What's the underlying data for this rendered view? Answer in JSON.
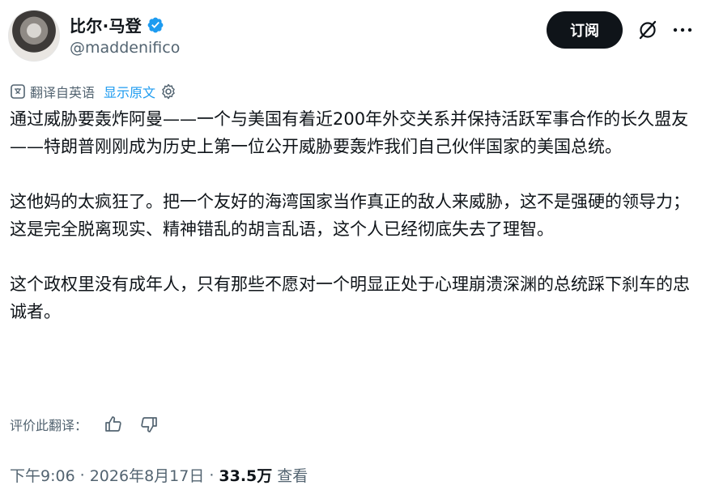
{
  "author": {
    "display_name": "比尔·马登",
    "handle": "@maddenifico",
    "verified": true,
    "verified_color": "#1d9bf0"
  },
  "header": {
    "subscribe_label": "订阅"
  },
  "translation": {
    "notice": "翻译自英语",
    "show_original": "显示原文"
  },
  "post": {
    "paragraphs": [
      "通过威胁要轰炸阿曼——一个与美国有着近200年外交关系并保持活跃军事合作的长久盟友——特朗普刚刚成为历史上第一位公开威胁要轰炸我们自己伙伴国家的美国总统。",
      "这他妈的太疯狂了。把一个友好的海湾国家当作真正的敌人来威胁，这不是强硬的领导力；这是完全脱离现实、精神错乱的胡言乱语，这个人已经彻底失去了理智。",
      "这个政权里没有成年人，只有那些不愿对一个明显正处于心理崩溃深渊的总统踩下刹车的忠诚者。"
    ]
  },
  "rating": {
    "label": "评价此翻译："
  },
  "meta": {
    "time": "下午9:06",
    "date": "2026年8月17日",
    "separator": "·",
    "views_count": "33.5万",
    "views_label": "查看"
  },
  "icons": [
    "verified-badge-icon",
    "grok-icon",
    "more-icon",
    "translate-icon",
    "settings-icon",
    "thumbs-up-icon",
    "thumbs-down-icon"
  ]
}
